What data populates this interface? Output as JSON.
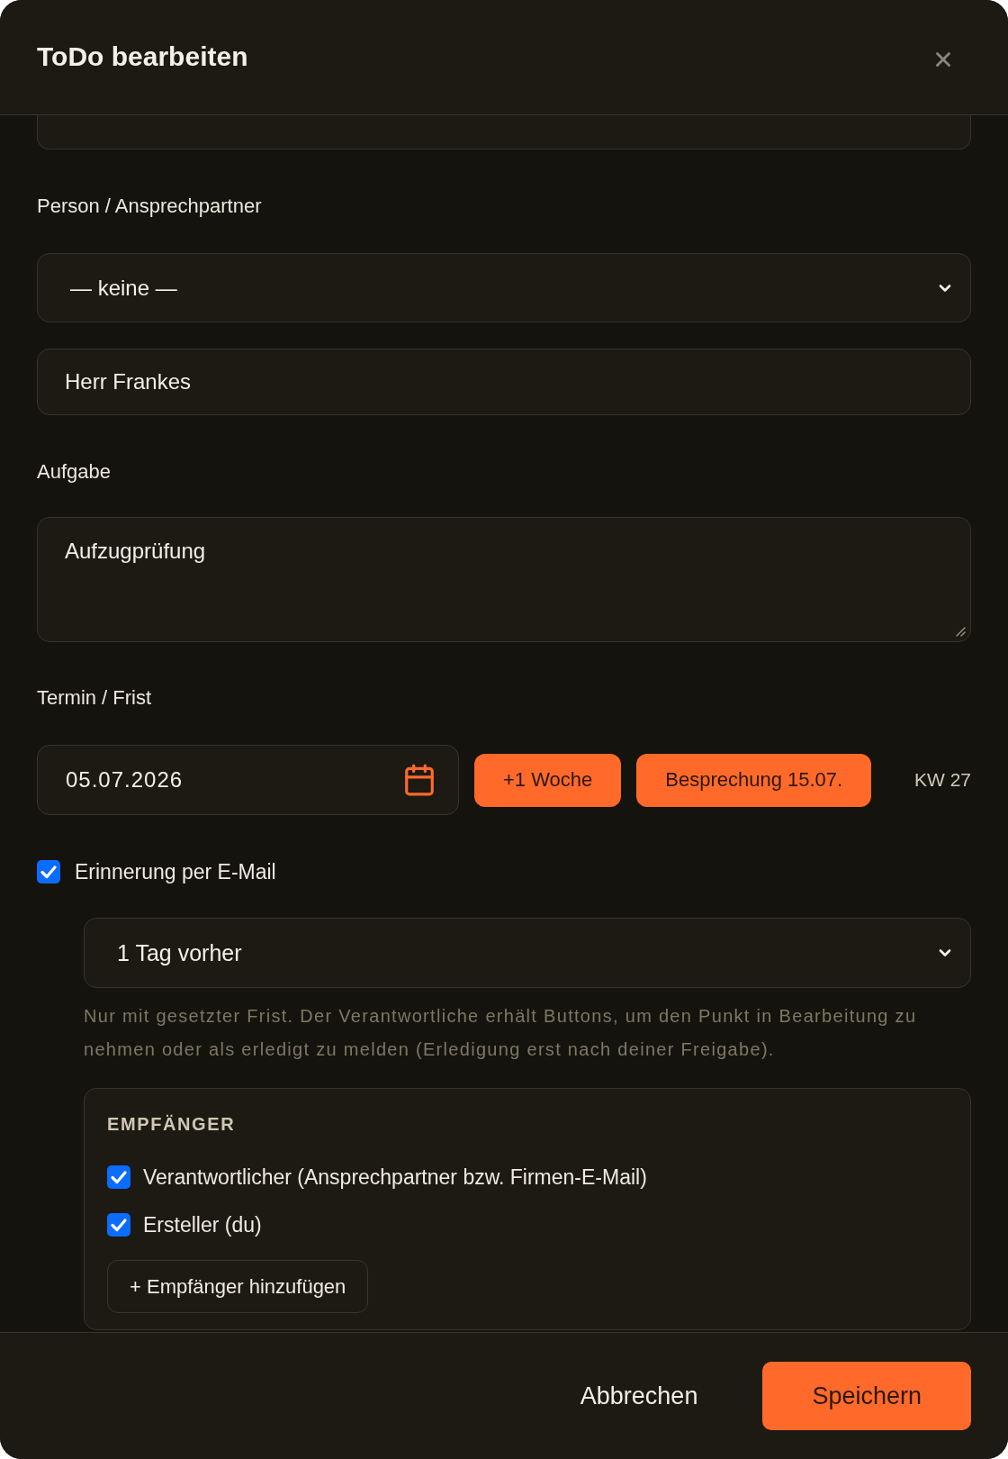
{
  "dialog": {
    "title": "ToDo bearbeiten"
  },
  "contact": {
    "label": "Person / Ansprechpartner",
    "select_value": "— keine —",
    "name_value": "Herr Frankes"
  },
  "task": {
    "label": "Aufgabe",
    "value": "Aufzugprüfung"
  },
  "deadline": {
    "label": "Termin / Frist",
    "date": "05.07.2026",
    "quick_buttons": [
      "+1 Woche",
      "Besprechung 15.07."
    ],
    "week": "KW 27"
  },
  "reminder": {
    "label": "Erinnerung per E-Mail",
    "checked": true,
    "lead_time": "1 Tag vorher",
    "hint": "Nur mit gesetzter Frist. Der Verantwortliche erhält Buttons, um den Punkt in Bearbeitung zu nehmen oder als erledigt zu melden (Erledigung erst nach deiner Freigabe).",
    "recipients": {
      "heading": "EMPFÄNGER",
      "items": [
        {
          "label": "Verantwortlicher (Ansprechpartner bzw. Firmen-E-Mail)",
          "checked": true
        },
        {
          "label": "Ersteller (du)",
          "checked": true
        }
      ],
      "add_button": "+ Empfänger hinzufügen"
    }
  },
  "footer": {
    "buttons": [
      {
        "label": "Abbrechen",
        "kind": "secondary"
      },
      {
        "label": "Speichern",
        "kind": "primary"
      }
    ]
  }
}
